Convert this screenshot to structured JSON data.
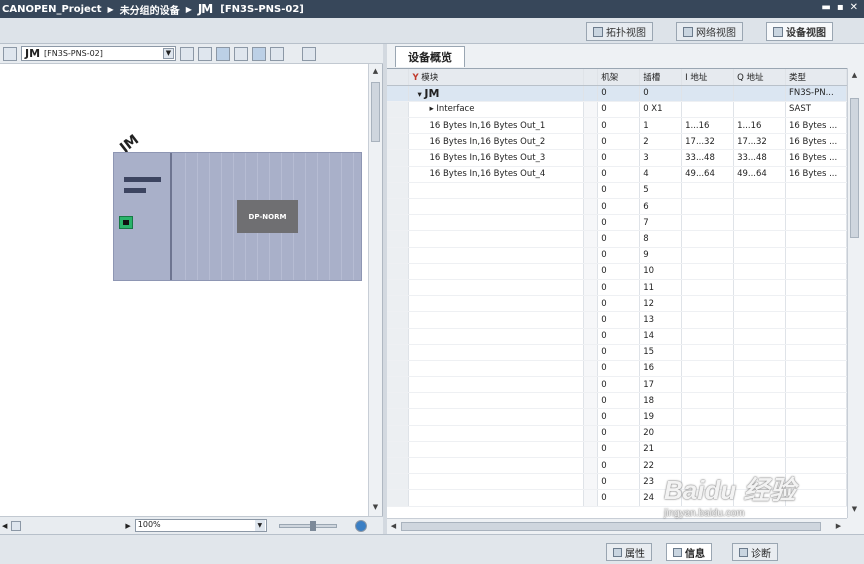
{
  "titlebar": {
    "project": "CANOPEN_Project",
    "group": "未分组的设备",
    "device_logo": "JM",
    "device_name": "[FN3S-PNS-02]",
    "window_controls": [
      "▬",
      "▪",
      "✕"
    ]
  },
  "view_tabs": [
    {
      "label": "拓扑视图",
      "icon": "topology-icon",
      "active": false
    },
    {
      "label": "网络视图",
      "icon": "network-icon",
      "active": false
    },
    {
      "label": "设备视图",
      "icon": "device-icon",
      "active": true
    }
  ],
  "left_panel": {
    "device_select": {
      "logo": "JM",
      "value": "[FN3S-PNS-02]"
    },
    "device_label": "JM",
    "module_label": "DP-NORM",
    "zoom": "100%"
  },
  "overview": {
    "tab_label": "设备概览",
    "columns": [
      "模块",
      "机架",
      "插槽",
      "I 地址",
      "Q 地址",
      "类型"
    ],
    "rows": [
      {
        "module": "JM",
        "rack": "0",
        "slot": "0",
        "i": "",
        "q": "",
        "type": "FN3S-PN...",
        "level": 0,
        "expand": "▾",
        "selected": true
      },
      {
        "module": "Interface",
        "rack": "0",
        "slot": "0 X1",
        "i": "",
        "q": "",
        "type": "SAST",
        "level": 1,
        "expand": "▸",
        "selected": false
      },
      {
        "module": "16 Bytes In,16 Bytes Out_1",
        "rack": "0",
        "slot": "1",
        "i": "1...16",
        "q": "1...16",
        "type": "16 Bytes ...",
        "level": 2
      },
      {
        "module": "16 Bytes In,16 Bytes Out_2",
        "rack": "0",
        "slot": "2",
        "i": "17...32",
        "q": "17...32",
        "type": "16 Bytes ...",
        "level": 2
      },
      {
        "module": "16 Bytes In,16 Bytes Out_3",
        "rack": "0",
        "slot": "3",
        "i": "33...48",
        "q": "33...48",
        "type": "16 Bytes ...",
        "level": 2
      },
      {
        "module": "16 Bytes In,16 Bytes Out_4",
        "rack": "0",
        "slot": "4",
        "i": "49...64",
        "q": "49...64",
        "type": "16 Bytes ...",
        "level": 2
      },
      {
        "module": "",
        "rack": "0",
        "slot": "5",
        "i": "",
        "q": "",
        "type": "",
        "level": 2
      },
      {
        "module": "",
        "rack": "0",
        "slot": "6",
        "i": "",
        "q": "",
        "type": "",
        "level": 2
      },
      {
        "module": "",
        "rack": "0",
        "slot": "7",
        "i": "",
        "q": "",
        "type": "",
        "level": 2
      },
      {
        "module": "",
        "rack": "0",
        "slot": "8",
        "i": "",
        "q": "",
        "type": "",
        "level": 2
      },
      {
        "module": "",
        "rack": "0",
        "slot": "9",
        "i": "",
        "q": "",
        "type": "",
        "level": 2
      },
      {
        "module": "",
        "rack": "0",
        "slot": "10",
        "i": "",
        "q": "",
        "type": "",
        "level": 2
      },
      {
        "module": "",
        "rack": "0",
        "slot": "11",
        "i": "",
        "q": "",
        "type": "",
        "level": 2
      },
      {
        "module": "",
        "rack": "0",
        "slot": "12",
        "i": "",
        "q": "",
        "type": "",
        "level": 2
      },
      {
        "module": "",
        "rack": "0",
        "slot": "13",
        "i": "",
        "q": "",
        "type": "",
        "level": 2
      },
      {
        "module": "",
        "rack": "0",
        "slot": "14",
        "i": "",
        "q": "",
        "type": "",
        "level": 2
      },
      {
        "module": "",
        "rack": "0",
        "slot": "15",
        "i": "",
        "q": "",
        "type": "",
        "level": 2
      },
      {
        "module": "",
        "rack": "0",
        "slot": "16",
        "i": "",
        "q": "",
        "type": "",
        "level": 2
      },
      {
        "module": "",
        "rack": "0",
        "slot": "17",
        "i": "",
        "q": "",
        "type": "",
        "level": 2
      },
      {
        "module": "",
        "rack": "0",
        "slot": "18",
        "i": "",
        "q": "",
        "type": "",
        "level": 2
      },
      {
        "module": "",
        "rack": "0",
        "slot": "19",
        "i": "",
        "q": "",
        "type": "",
        "level": 2
      },
      {
        "module": "",
        "rack": "0",
        "slot": "20",
        "i": "",
        "q": "",
        "type": "",
        "level": 2
      },
      {
        "module": "",
        "rack": "0",
        "slot": "21",
        "i": "",
        "q": "",
        "type": "",
        "level": 2
      },
      {
        "module": "",
        "rack": "0",
        "slot": "22",
        "i": "",
        "q": "",
        "type": "",
        "level": 2
      },
      {
        "module": "",
        "rack": "0",
        "slot": "23",
        "i": "",
        "q": "",
        "type": "",
        "level": 2
      },
      {
        "module": "",
        "rack": "0",
        "slot": "24",
        "i": "",
        "q": "",
        "type": "",
        "level": 2
      }
    ]
  },
  "bottom_tabs": [
    {
      "label": "属性",
      "icon": "properties-icon",
      "active": false
    },
    {
      "label": "信息",
      "icon": "info-icon",
      "active": true
    },
    {
      "label": "诊断",
      "icon": "diagnostics-icon",
      "active": false
    }
  ],
  "watermark": {
    "brand": "Baidu 经验",
    "url": "jingyan.baidu.com"
  },
  "colors": {
    "titlebar": "#37475a",
    "device_body": "#a9b0c9",
    "port": "#29b36a",
    "selected_row": "#dbe6f2"
  }
}
